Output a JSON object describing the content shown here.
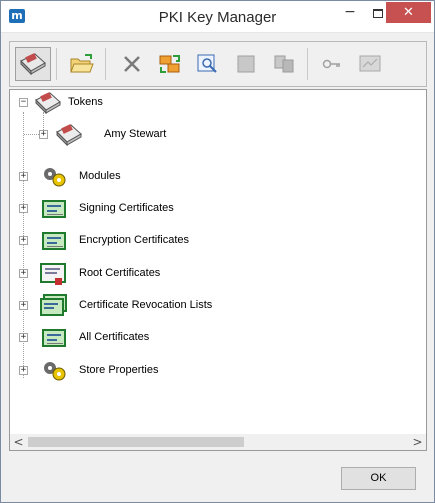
{
  "window": {
    "title": "PKI Key Manager",
    "app_icon": "m",
    "minimize_glyph": "−",
    "close_glyph": "✕"
  },
  "toolbar": {
    "buttons": [
      {
        "icon": "token-reader-icon"
      },
      {
        "icon": "open-folder-icon"
      },
      {
        "icon": "delete-icon"
      },
      {
        "icon": "import-export-icon"
      },
      {
        "icon": "view-certificate-icon"
      },
      {
        "icon": "disabled-icon"
      },
      {
        "icon": "copy-icon"
      },
      {
        "icon": "key-icon"
      },
      {
        "icon": "certificate-properties-icon"
      }
    ]
  },
  "tree": {
    "items": [
      {
        "label": "Tokens",
        "expander": "−",
        "icon": "token-reader-icon"
      },
      {
        "label": "Amy Stewart",
        "expander": "+",
        "icon": "token-reader-icon"
      },
      {
        "label": "Modules",
        "expander": "+",
        "icon": "modules-gear-icon"
      },
      {
        "label": "Signing Certificates",
        "expander": "+",
        "icon": "certificate-icon"
      },
      {
        "label": "Encryption Certificates",
        "expander": "+",
        "icon": "certificate-icon"
      },
      {
        "label": "Root Certificates",
        "expander": "+",
        "icon": "root-certificate-icon"
      },
      {
        "label": "Certificate Revocation Lists",
        "expander": "+",
        "icon": "crl-icon"
      },
      {
        "label": "All Certificates",
        "expander": "+",
        "icon": "certificate-icon"
      },
      {
        "label": "Store Properties",
        "expander": "+",
        "icon": "store-properties-gear-icon"
      }
    ]
  },
  "scrollbar": {
    "left_arrow": "<",
    "right_arrow": ">"
  },
  "footer": {
    "ok_label": "OK"
  }
}
